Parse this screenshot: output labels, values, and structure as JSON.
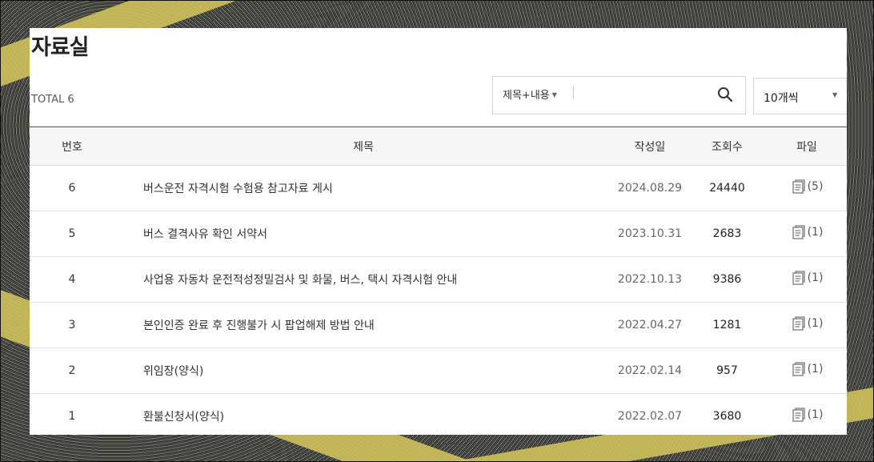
{
  "page": {
    "title": "자료실",
    "total_label": "TOTAL 6"
  },
  "search": {
    "scope_label": "제목+내용",
    "input_value": "",
    "placeholder": ""
  },
  "per_page": {
    "selected": "10개씩"
  },
  "table": {
    "headers": {
      "no": "번호",
      "title": "제목",
      "date": "작성일",
      "views": "조회수",
      "file": "파일"
    },
    "rows": [
      {
        "no": "6",
        "title": "버스운전 자격시험 수험용 참고자료 게시",
        "date": "2024.08.29",
        "views": "24440",
        "file_count": "(5)"
      },
      {
        "no": "5",
        "title": "버스 결격사유 확인 서약서",
        "date": "2023.10.31",
        "views": "2683",
        "file_count": "(1)"
      },
      {
        "no": "4",
        "title": "사업용 자동차 운전적성정밀검사 및 화물, 버스, 택시 자격시험 안내",
        "date": "2022.10.13",
        "views": "9386",
        "file_count": "(1)"
      },
      {
        "no": "3",
        "title": "본인인증 완료 후 진행불가 시 팝업해제 방법 안내",
        "date": "2022.04.27",
        "views": "1281",
        "file_count": "(1)"
      },
      {
        "no": "2",
        "title": "위임장(양식)",
        "date": "2022.02.14",
        "views": "957",
        "file_count": "(1)"
      },
      {
        "no": "1",
        "title": "환불신청서(양식)",
        "date": "2022.02.07",
        "views": "3680",
        "file_count": "(1)"
      }
    ]
  },
  "icons": {
    "search": "search-icon",
    "file": "file-icon",
    "dropdown": "chevron-down-icon"
  }
}
